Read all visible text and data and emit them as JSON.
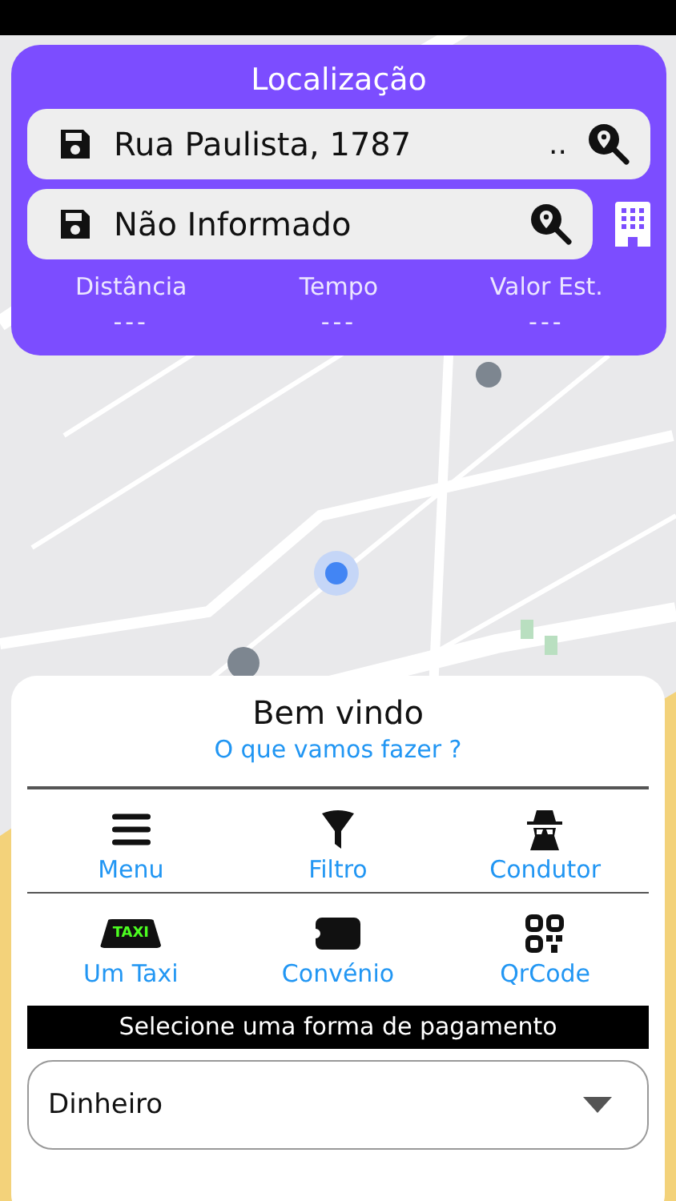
{
  "header": {
    "title": "Localização"
  },
  "fields": [
    {
      "value": "Rua Paulista, 1787",
      "suffix": "..",
      "building": false
    },
    {
      "value": "Não Informado",
      "building": true
    }
  ],
  "stats": [
    {
      "label": "Distância",
      "value": "---"
    },
    {
      "label": "Tempo",
      "value": "---"
    },
    {
      "label": "Valor Est.",
      "value": "---"
    }
  ],
  "welcome": {
    "title": "Bem vindo",
    "subtitle": "O que vamos fazer ?"
  },
  "actions": [
    [
      {
        "kind": "menu",
        "label": "Menu"
      },
      {
        "kind": "filter",
        "label": "Filtro"
      },
      {
        "kind": "driver",
        "label": "Condutor"
      }
    ],
    [
      {
        "kind": "taxi",
        "label": "Um Taxi",
        "badge": "TAXI"
      },
      {
        "kind": "ticket",
        "label": "Convénio"
      },
      {
        "kind": "qrcode",
        "label": "QrCode"
      }
    ]
  ],
  "payment": {
    "banner": "Selecione uma forma de pagamento",
    "value": "Dinheiro"
  }
}
